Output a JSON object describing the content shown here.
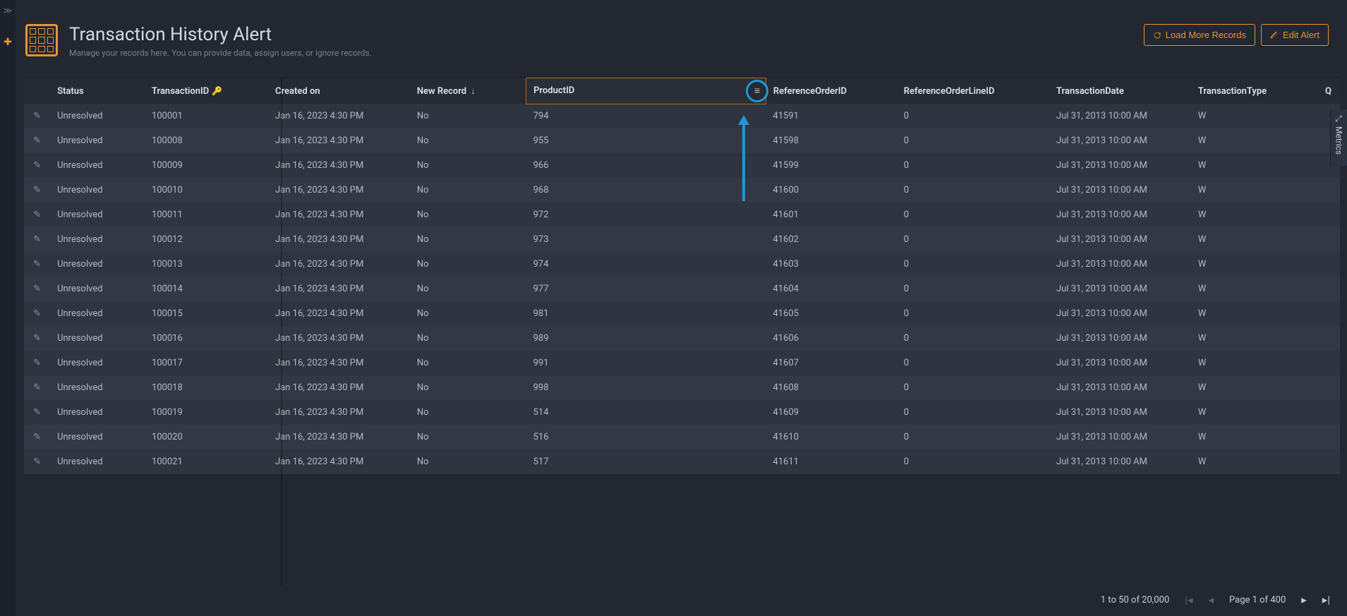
{
  "header": {
    "title": "Transaction History Alert",
    "subtitle": "Manage your records here. You can provide data, assign users, or ignore records."
  },
  "actions": {
    "load_more": "Load More Records",
    "edit_alert": "Edit Alert"
  },
  "columns": {
    "status": "Status",
    "transaction_id": "TransactionID",
    "created_on": "Created on",
    "new_record": "New Record",
    "product_id": "ProductID",
    "reference_order_id": "ReferenceOrderID",
    "reference_order_line_id": "ReferenceOrderLineID",
    "transaction_date": "TransactionDate",
    "transaction_type": "TransactionType",
    "q": "Q"
  },
  "rows": [
    {
      "status": "Unresolved",
      "tid": "100001",
      "created": "Jan 16, 2023 4:30 PM",
      "new": "No",
      "pid": "794",
      "roid": "41591",
      "rolid": "0",
      "tdate": "Jul 31, 2013 10:00 AM",
      "ttype": "W"
    },
    {
      "status": "Unresolved",
      "tid": "100008",
      "created": "Jan 16, 2023 4:30 PM",
      "new": "No",
      "pid": "955",
      "roid": "41598",
      "rolid": "0",
      "tdate": "Jul 31, 2013 10:00 AM",
      "ttype": "W"
    },
    {
      "status": "Unresolved",
      "tid": "100009",
      "created": "Jan 16, 2023 4:30 PM",
      "new": "No",
      "pid": "966",
      "roid": "41599",
      "rolid": "0",
      "tdate": "Jul 31, 2013 10:00 AM",
      "ttype": "W"
    },
    {
      "status": "Unresolved",
      "tid": "100010",
      "created": "Jan 16, 2023 4:30 PM",
      "new": "No",
      "pid": "968",
      "roid": "41600",
      "rolid": "0",
      "tdate": "Jul 31, 2013 10:00 AM",
      "ttype": "W"
    },
    {
      "status": "Unresolved",
      "tid": "100011",
      "created": "Jan 16, 2023 4:30 PM",
      "new": "No",
      "pid": "972",
      "roid": "41601",
      "rolid": "0",
      "tdate": "Jul 31, 2013 10:00 AM",
      "ttype": "W"
    },
    {
      "status": "Unresolved",
      "tid": "100012",
      "created": "Jan 16, 2023 4:30 PM",
      "new": "No",
      "pid": "973",
      "roid": "41602",
      "rolid": "0",
      "tdate": "Jul 31, 2013 10:00 AM",
      "ttype": "W"
    },
    {
      "status": "Unresolved",
      "tid": "100013",
      "created": "Jan 16, 2023 4:30 PM",
      "new": "No",
      "pid": "974",
      "roid": "41603",
      "rolid": "0",
      "tdate": "Jul 31, 2013 10:00 AM",
      "ttype": "W"
    },
    {
      "status": "Unresolved",
      "tid": "100014",
      "created": "Jan 16, 2023 4:30 PM",
      "new": "No",
      "pid": "977",
      "roid": "41604",
      "rolid": "0",
      "tdate": "Jul 31, 2013 10:00 AM",
      "ttype": "W"
    },
    {
      "status": "Unresolved",
      "tid": "100015",
      "created": "Jan 16, 2023 4:30 PM",
      "new": "No",
      "pid": "981",
      "roid": "41605",
      "rolid": "0",
      "tdate": "Jul 31, 2013 10:00 AM",
      "ttype": "W"
    },
    {
      "status": "Unresolved",
      "tid": "100016",
      "created": "Jan 16, 2023 4:30 PM",
      "new": "No",
      "pid": "989",
      "roid": "41606",
      "rolid": "0",
      "tdate": "Jul 31, 2013 10:00 AM",
      "ttype": "W"
    },
    {
      "status": "Unresolved",
      "tid": "100017",
      "created": "Jan 16, 2023 4:30 PM",
      "new": "No",
      "pid": "991",
      "roid": "41607",
      "rolid": "0",
      "tdate": "Jul 31, 2013 10:00 AM",
      "ttype": "W"
    },
    {
      "status": "Unresolved",
      "tid": "100018",
      "created": "Jan 16, 2023 4:30 PM",
      "new": "No",
      "pid": "998",
      "roid": "41608",
      "rolid": "0",
      "tdate": "Jul 31, 2013 10:00 AM",
      "ttype": "W"
    },
    {
      "status": "Unresolved",
      "tid": "100019",
      "created": "Jan 16, 2023 4:30 PM",
      "new": "No",
      "pid": "514",
      "roid": "41609",
      "rolid": "0",
      "tdate": "Jul 31, 2013 10:00 AM",
      "ttype": "W"
    },
    {
      "status": "Unresolved",
      "tid": "100020",
      "created": "Jan 16, 2023 4:30 PM",
      "new": "No",
      "pid": "516",
      "roid": "41610",
      "rolid": "0",
      "tdate": "Jul 31, 2013 10:00 AM",
      "ttype": "W"
    },
    {
      "status": "Unresolved",
      "tid": "100021",
      "created": "Jan 16, 2023 4:30 PM",
      "new": "No",
      "pid": "517",
      "roid": "41611",
      "rolid": "0",
      "tdate": "Jul 31, 2013 10:00 AM",
      "ttype": "W"
    }
  ],
  "metrics_tab": "Metrics",
  "footer": {
    "range": "1 to 50 of 20,000",
    "page_label": "Page 1 of 400"
  }
}
